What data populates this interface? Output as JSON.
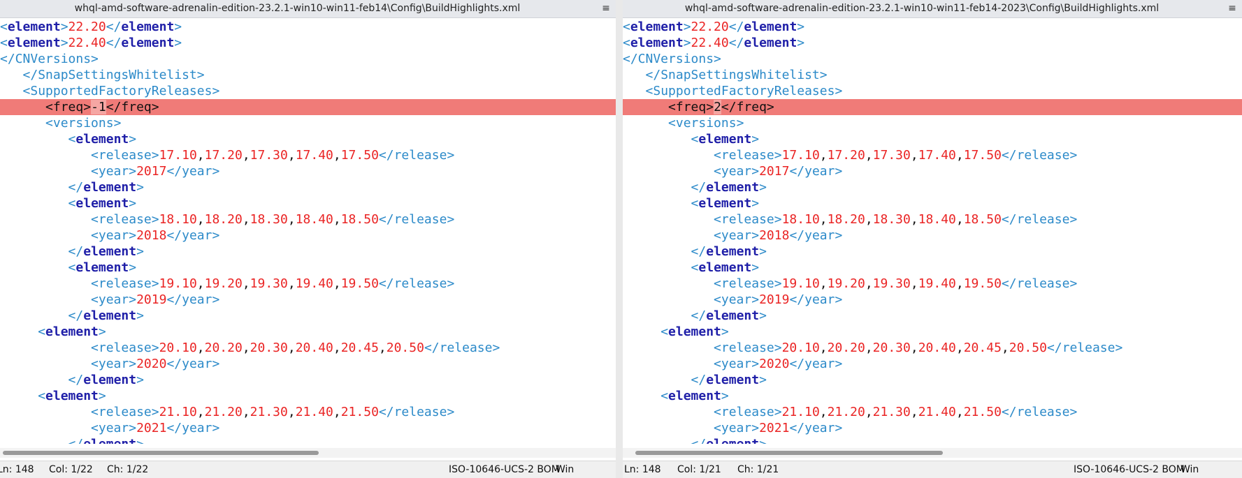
{
  "colors": {
    "tag": "#2c8ac9",
    "element_name": "#1f1fa8",
    "value": "#ea2424",
    "diff_line": "#f07b78",
    "diff_char": "#f5a6a3"
  },
  "left": {
    "title": "whql-amd-software-adrenalin-edition-23.2.1-win10-win11-feb14\\Config\\BuildHighlights.xml",
    "menu_icon": "hamburger-menu-icon",
    "freq_value": "-1",
    "status": {
      "ln": "Ln: 148",
      "col": "Col: 1/22",
      "ch": "Ch: 1/22",
      "encoding": "ISO-10646-UCS-2 BOM",
      "eol": "Win"
    }
  },
  "right": {
    "title": "whql-amd-software-adrenalin-edition-23.2.1-win10-win11-feb14-2023\\Config\\BuildHighlights.xml",
    "menu_icon": "hamburger-menu-icon",
    "freq_value": "2",
    "status": {
      "ln": "Ln: 148",
      "col": "Col: 1/21",
      "ch": "Ch: 1/21",
      "encoding": "ISO-10646-UCS-2 BOM",
      "eol": "Win"
    }
  },
  "code": {
    "el": "element",
    "v_2220": "22.20",
    "v_2240": "22.40",
    "cnversions_close": "</CNVersions>",
    "snap_close": "</SnapSettingsWhitelist>",
    "factory_open": "<SupportedFactoryReleases>",
    "freq_open": "<freq>",
    "freq_close": "</freq>",
    "versions_open": "<versions>",
    "release_open": "<release>",
    "release_close": "</release>",
    "year_open": "<year>",
    "year_close": "</year>",
    "r2017": [
      "17.10",
      "17.20",
      "17.30",
      "17.40",
      "17.50"
    ],
    "y2017": "2017",
    "r2018": [
      "18.10",
      "18.20",
      "18.30",
      "18.40",
      "18.50"
    ],
    "y2018": "2018",
    "r2019": [
      "19.10",
      "19.20",
      "19.30",
      "19.40",
      "19.50"
    ],
    "y2019": "2019",
    "r2020": [
      "20.10",
      "20.20",
      "20.30",
      "20.40",
      "20.45",
      "20.50"
    ],
    "y2020": "2020",
    "r2021": [
      "21.10",
      "21.20",
      "21.30",
      "21.40",
      "21.50"
    ],
    "y2021": "2021"
  }
}
